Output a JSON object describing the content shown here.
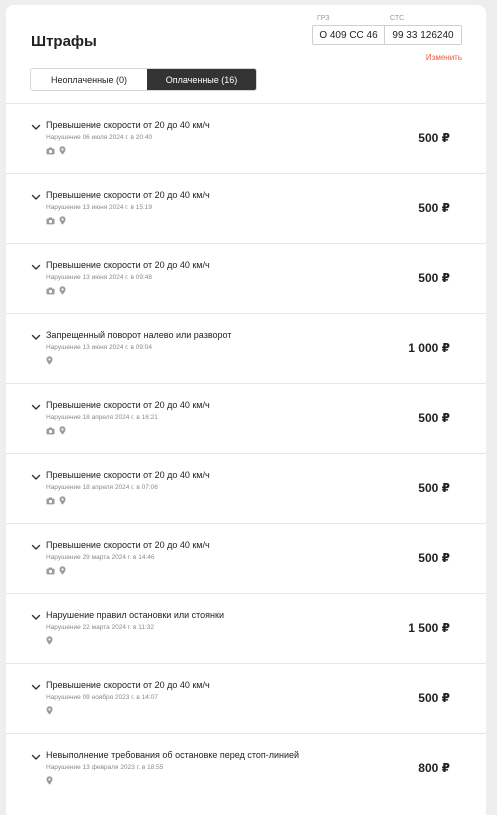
{
  "header": {
    "title": "Штрафы",
    "grz_label": "ГРЗ",
    "grz_value": "О 409 СС 46",
    "sts_label": "СТС",
    "sts_value": "99 33 126240",
    "change_label": "Изменить"
  },
  "tabs": [
    {
      "label": "Неоплаченные (0)",
      "active": false
    },
    {
      "label": "Оплаченные (16)",
      "active": true
    }
  ],
  "fines": [
    {
      "title": "Превышение скорости от 20 до 40 км/ч",
      "date": "Нарушение 06 июля 2024 г. в 20:40",
      "amount": "500 ₽",
      "icons": [
        "camera-icon",
        "location-pin-icon"
      ]
    },
    {
      "title": "Превышение скорости от 20 до 40 км/ч",
      "date": "Нарушение 13 июня 2024 г. в 15:19",
      "amount": "500 ₽",
      "icons": [
        "camera-icon",
        "location-pin-icon"
      ]
    },
    {
      "title": "Превышение скорости от 20 до 40 км/ч",
      "date": "Нарушение 13 июня 2024 г. в 09:48",
      "amount": "500 ₽",
      "icons": [
        "camera-icon",
        "location-pin-icon"
      ]
    },
    {
      "title": "Запрещенный поворот налево или разворот",
      "date": "Нарушение 13 июня 2024 г. в 09:04",
      "amount": "1 000 ₽",
      "icons": [
        "location-pin-icon"
      ]
    },
    {
      "title": "Превышение скорости от 20 до 40 км/ч",
      "date": "Нарушение 18 апреля 2024 г. в 16:21",
      "amount": "500 ₽",
      "icons": [
        "camera-icon",
        "location-pin-icon"
      ]
    },
    {
      "title": "Превышение скорости от 20 до 40 км/ч",
      "date": "Нарушение 18 апреля 2024 г. в 07:06",
      "amount": "500 ₽",
      "icons": [
        "camera-icon",
        "location-pin-icon"
      ]
    },
    {
      "title": "Превышение скорости от 20 до 40 км/ч",
      "date": "Нарушение 29 марта 2024 г. в 14:46",
      "amount": "500 ₽",
      "icons": [
        "camera-icon",
        "location-pin-icon"
      ]
    },
    {
      "title": "Нарушение правил остановки или стоянки",
      "date": "Нарушение 22 марта 2024 г. в 11:32",
      "amount": "1 500 ₽",
      "icons": [
        "location-pin-icon"
      ]
    },
    {
      "title": "Превышение скорости от 20 до 40 км/ч",
      "date": "Нарушение 09 ноября 2023 г. в 14:07",
      "amount": "500 ₽",
      "icons": [
        "location-pin-icon"
      ]
    },
    {
      "title": "Невыполнение требования об остановке перед стоп-линией",
      "date": "Нарушение 13 февраля 2023 г. в 18:55",
      "amount": "800 ₽",
      "icons": [
        "location-pin-icon"
      ]
    }
  ],
  "colors": {
    "accent": "#e85a3c",
    "active_tab_bg": "#333333"
  }
}
